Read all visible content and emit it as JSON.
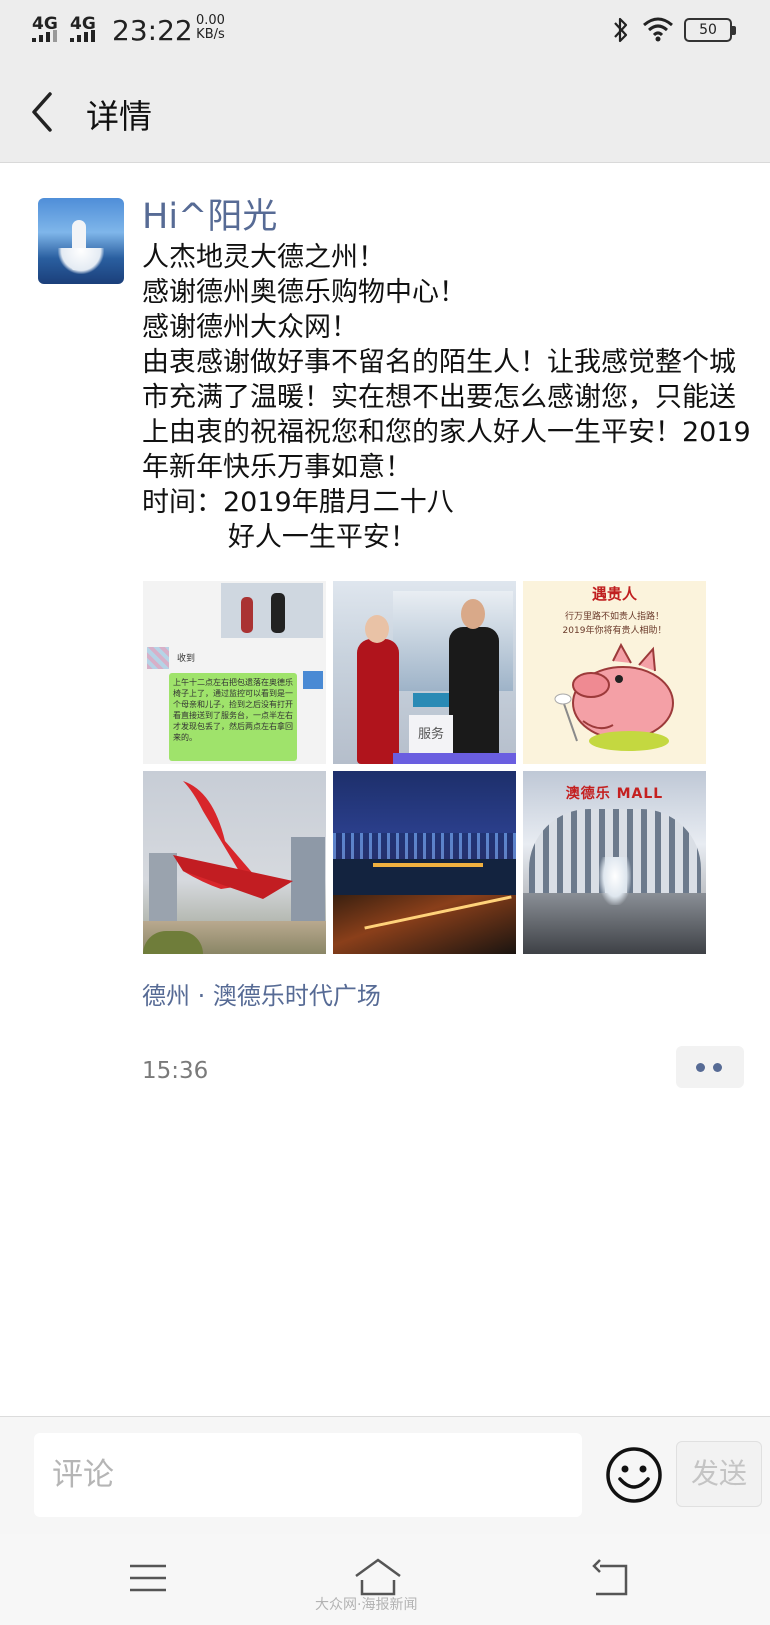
{
  "status_bar": {
    "signal_1": "4G",
    "signal_2": "4G",
    "time": "23:22",
    "speed_value": "0.00",
    "speed_unit": "KB/s",
    "battery": "50"
  },
  "nav": {
    "title": "详情",
    "back_icon": "chevron-left-icon"
  },
  "post": {
    "author": "Hi^阳光",
    "text": "人杰地灵大德之州！\n感谢德州奥德乐购物中心！\n感谢德州大众网！\n由衷感谢做好事不留名的陌生人！让我感觉整个城市充满了温暖！实在想不出要怎么感谢您，只能送上由衷的祝福祝您和您的家人好人一生平安！2019年新年快乐万事如意！\n时间：2019年腊月二十八\n          好人一生平安！",
    "images": [
      {
        "name": "chat-screenshot-image",
        "caption_top": "收到",
        "chat_text": "上午十二点左右把包遗落在奥德乐椅子上了，通过监控可以看到是一个母亲和儿子，捡到之后没有打开看直接送到了服务台，一点半左右才发现包丢了，然后两点左右拿回来的。"
      },
      {
        "name": "service-desk-photo-image",
        "sign": "服务"
      },
      {
        "name": "pig-card-image",
        "title": "遇贵人",
        "line1": "行万里路不如贵人指路！",
        "line2": "2019年你将有贵人相助！"
      },
      {
        "name": "red-sculpture-image"
      },
      {
        "name": "city-night-image"
      },
      {
        "name": "mall-fountain-image",
        "sign": "澳德乐 MALL"
      }
    ],
    "location": "德州 · 澳德乐时代广场",
    "time": "15:36"
  },
  "comment_bar": {
    "placeholder": "评论",
    "value": "",
    "send_label": "发送",
    "emoji_icon": "smiley-icon"
  },
  "system_nav": {
    "menu_icon": "menu-icon",
    "home_icon": "home-icon",
    "back_icon": "return-icon",
    "watermark": "大众网·海报新闻"
  },
  "colors": {
    "link": "#576b95",
    "header_bg": "#ededed"
  }
}
